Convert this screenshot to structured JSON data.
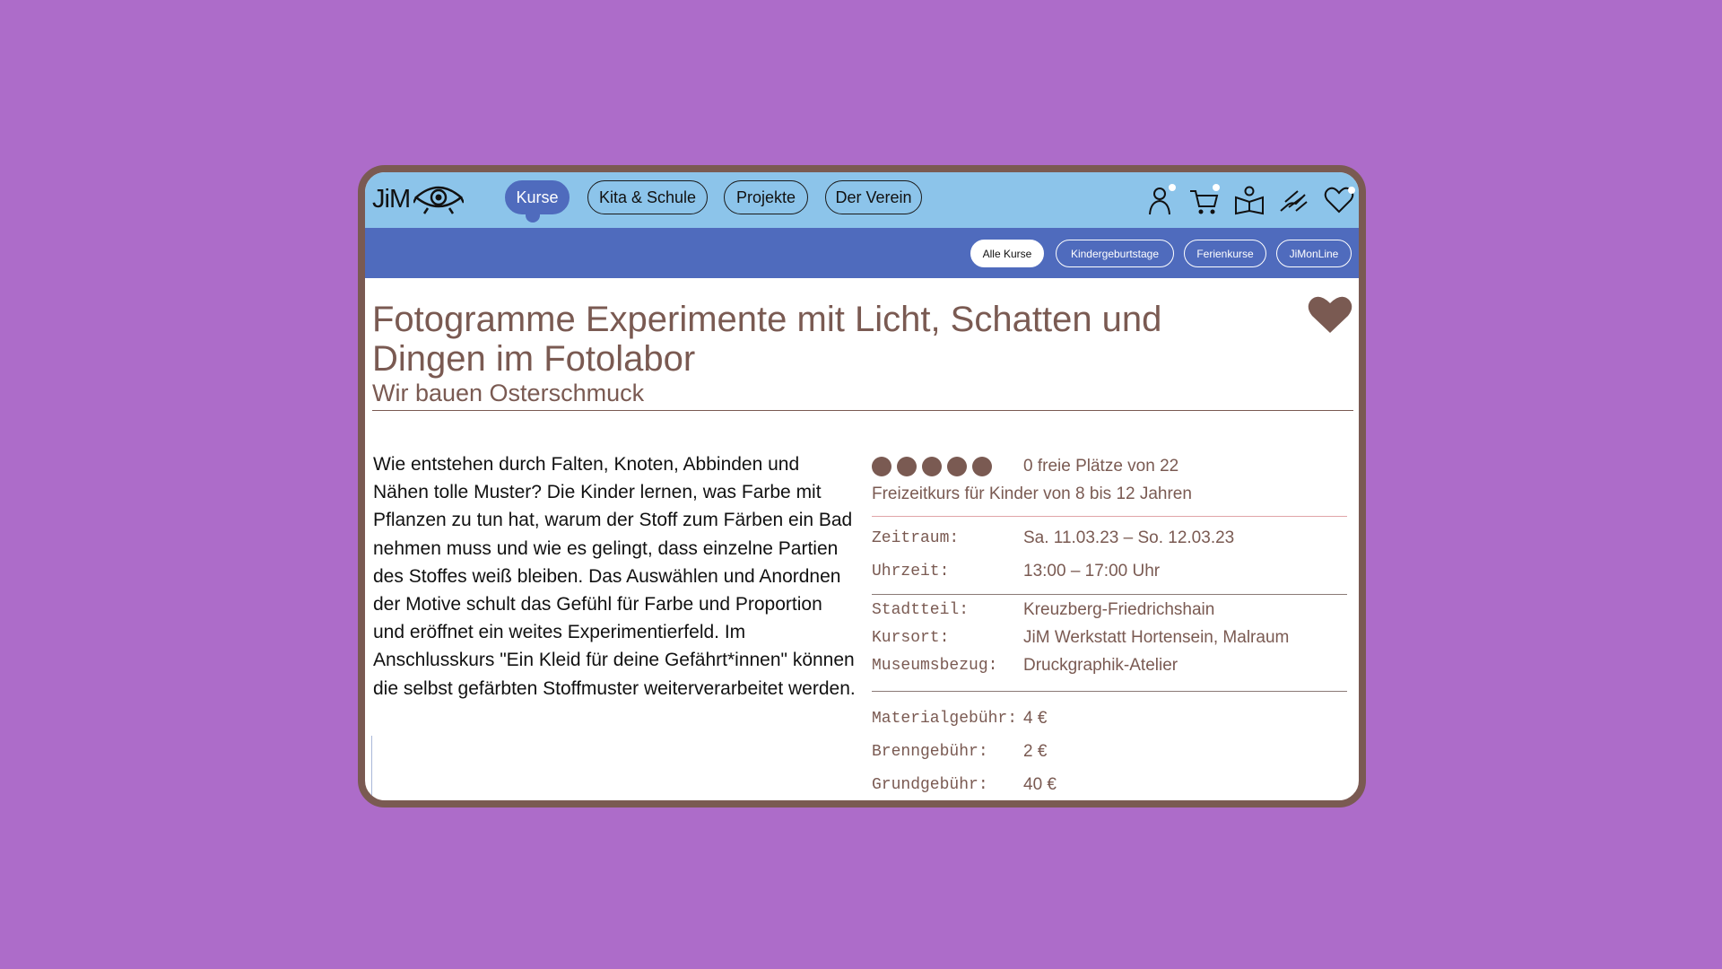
{
  "logo": {
    "text": "JiM",
    "icon": "eye-icon"
  },
  "main_nav": [
    {
      "label": "Kurse",
      "active": true
    },
    {
      "label": "Kita & Schule",
      "active": false
    },
    {
      "label": "Projekte",
      "active": false
    },
    {
      "label": "Der Verein",
      "active": false
    }
  ],
  "header_icons": [
    "user-icon",
    "cart-icon",
    "book-icon",
    "donate-hand-icon",
    "heart-outline-icon"
  ],
  "sub_nav": [
    {
      "label": "Alle Kurse",
      "active": true
    },
    {
      "label": "Kindergeburtstage",
      "active": false
    },
    {
      "label": "Ferienkurse",
      "active": false
    },
    {
      "label": "JiMonLine",
      "active": false
    }
  ],
  "course": {
    "title": "Fotogramme Experimente mit Licht, Schatten und Dingen im Fotolabor",
    "subtitle": "Wir bauen Osterschmuck",
    "description": "Wie entstehen durch Falten, Knoten, Abbinden und Nähen tolle Muster? Die Kinder lernen, was Farbe mit Pflanzen zu tun hat, warum der Stoff zum Färben ein Bad nehmen muss und wie es gelingt, dass einzelne Partien des Stoffes weiß bleiben. Das Auswählen und Anordnen der Motive schult das Gefühl für Farbe und Proportion und eröffnet ein weites Experimentierfeld. Im Anschlusskurs \"Ein Kleid für deine Gefährt*innen\" können die selbst gefärbten Stoffmuster weiterverarbeitet werden.",
    "availability_dots": 5,
    "seats": "0 freie Plätze von 22",
    "audience": "Freizeitkurs für Kinder von 8 bis 12 Jahren",
    "details": {
      "zeitraum_label": "Zeitraum:",
      "zeitraum": "Sa. 11.03.23 – So. 12.03.23",
      "uhrzeit_label": "Uhrzeit:",
      "uhrzeit": "13:00 – 17:00 Uhr",
      "stadtteil_label": "Stadtteil:",
      "stadtteil": "Kreuzberg-Friedrichshain",
      "kursort_label": "Kursort:",
      "kursort": "JiM Werkstatt Hortensein, Malraum",
      "museum_label": "Museumsbezug:",
      "museum": "Druckgraphik-Atelier",
      "material_label": "Materialgebühr:",
      "material": "4 €",
      "brenn_label": "Brenngebühr:",
      "brenn": "2 €",
      "grund_label": "Grundgebühr:",
      "grund": "40 €"
    }
  },
  "colors": {
    "page_background": "#ad6cc9",
    "frame_border": "#7a5a52",
    "top_nav": "#8cc4ea",
    "sub_nav": "#4f6bbd",
    "accent_text": "#7a5a52",
    "divider_pink": "#e0a4a8"
  }
}
